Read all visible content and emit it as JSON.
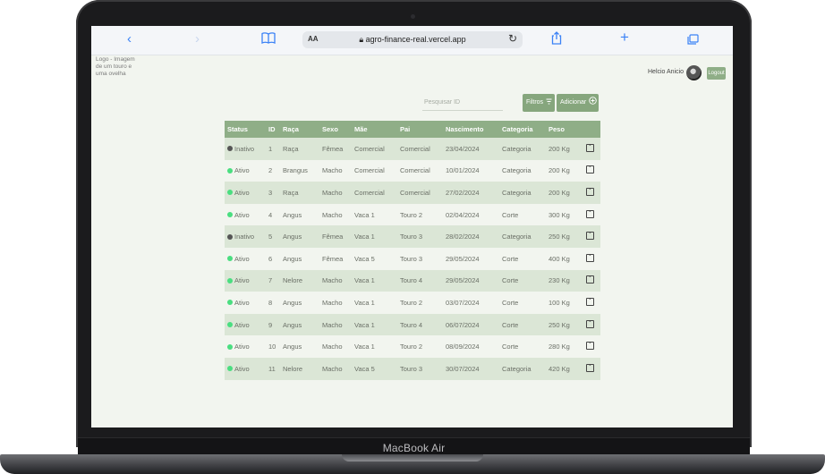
{
  "device": {
    "label": "MacBook Air"
  },
  "browser": {
    "url": "agro-finance-real.vercel.app",
    "text_size_label": "AA",
    "icons": [
      "back-icon",
      "forward-icon",
      "bookmarks-icon",
      "lock-icon",
      "reload-icon",
      "share-icon",
      "new-tab-icon",
      "tabs-icon"
    ]
  },
  "header": {
    "logo_alt": "Logo - Imagem de um touro e uma ovelha",
    "user_name": "Helcio Anicio",
    "logout_label": "Logout"
  },
  "controls": {
    "search_placeholder": "Pesquisar ID",
    "filter_label": "Filtros",
    "add_label": "Adicionar"
  },
  "colors": {
    "accent": "#8fae87",
    "row_alt": "#dbe6d6",
    "active": "#4ade80",
    "inactive": "#555555"
  },
  "table": {
    "columns": [
      "Status",
      "ID",
      "Raça",
      "Sexo",
      "Mãe",
      "Pai",
      "Nascimento",
      "Categoria",
      "Peso",
      ""
    ],
    "rows": [
      {
        "status": "Inativo",
        "id": "1",
        "raca": "Raça",
        "sexo": "Fêmea",
        "mae": "Comercial",
        "pai": "Comercial",
        "nasc": "23/04/2024",
        "cat": "Categoria",
        "peso": "200 Kg"
      },
      {
        "status": "Ativo",
        "id": "2",
        "raca": "Brangus",
        "sexo": "Macho",
        "mae": "Comercial",
        "pai": "Comercial",
        "nasc": "10/01/2024",
        "cat": "Categoria",
        "peso": "200 Kg"
      },
      {
        "status": "Ativo",
        "id": "3",
        "raca": "Raça",
        "sexo": "Macho",
        "mae": "Comercial",
        "pai": "Comercial",
        "nasc": "27/02/2024",
        "cat": "Categoria",
        "peso": "200 Kg"
      },
      {
        "status": "Ativo",
        "id": "4",
        "raca": "Angus",
        "sexo": "Macho",
        "mae": "Vaca 1",
        "pai": "Touro 2",
        "nasc": "02/04/2024",
        "cat": "Corte",
        "peso": "300 Kg"
      },
      {
        "status": "Inativo",
        "id": "5",
        "raca": "Angus",
        "sexo": "Fêmea",
        "mae": "Vaca 1",
        "pai": "Touro 3",
        "nasc": "28/02/2024",
        "cat": "Categoria",
        "peso": "250 Kg"
      },
      {
        "status": "Ativo",
        "id": "6",
        "raca": "Angus",
        "sexo": "Fêmea",
        "mae": "Vaca 5",
        "pai": "Touro 3",
        "nasc": "29/05/2024",
        "cat": "Corte",
        "peso": "400 Kg"
      },
      {
        "status": "Ativo",
        "id": "7",
        "raca": "Nelore",
        "sexo": "Macho",
        "mae": "Vaca 1",
        "pai": "Touro 4",
        "nasc": "29/05/2024",
        "cat": "Corte",
        "peso": "230 Kg"
      },
      {
        "status": "Ativo",
        "id": "8",
        "raca": "Angus",
        "sexo": "Macho",
        "mae": "Vaca 1",
        "pai": "Touro 2",
        "nasc": "03/07/2024",
        "cat": "Corte",
        "peso": "100 Kg"
      },
      {
        "status": "Ativo",
        "id": "9",
        "raca": "Angus",
        "sexo": "Macho",
        "mae": "Vaca 1",
        "pai": "Touro 4",
        "nasc": "06/07/2024",
        "cat": "Corte",
        "peso": "250 Kg"
      },
      {
        "status": "Ativo",
        "id": "10",
        "raca": "Angus",
        "sexo": "Macho",
        "mae": "Vaca 1",
        "pai": "Touro 2",
        "nasc": "08/09/2024",
        "cat": "Corte",
        "peso": "280 Kg"
      },
      {
        "status": "Ativo",
        "id": "11",
        "raca": "Nelore",
        "sexo": "Macho",
        "mae": "Vaca 5",
        "pai": "Touro 3",
        "nasc": "30/07/2024",
        "cat": "Categoria",
        "peso": "420 Kg"
      }
    ]
  }
}
